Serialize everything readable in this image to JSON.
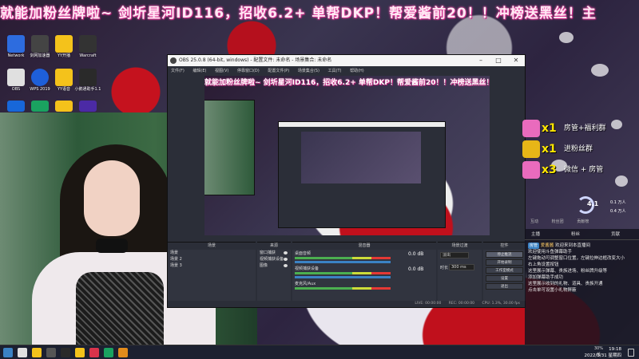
{
  "marquee": {
    "text": "就能加粉丝牌啦~  剑圻星河ID116，招收6.2+ 单帮DKP！帮爱酱前20！！冲榜送黑丝！主"
  },
  "desktop_icons": [
    {
      "label": "Network",
      "icon": "network-icon",
      "color": "#2d6cdf"
    },
    {
      "label": "剑网加速器",
      "icon": "accelerator-icon",
      "color": "#444"
    },
    {
      "label": "YY开播",
      "icon": "yy-live-icon",
      "color": "#f4c21b"
    },
    {
      "label": "Warcraft",
      "icon": "warcraft-icon",
      "color": "#333"
    },
    {
      "label": "OBS",
      "icon": "obs-icon",
      "color": "#e0e0e0"
    },
    {
      "label": "WPS 2019",
      "icon": "wps-icon",
      "color": "#1e5fd9"
    },
    {
      "label": "YY语音",
      "icon": "yy-voice-icon",
      "color": "#f4c21b"
    },
    {
      "label": "小鹅通助手1.1",
      "icon": "assistant-icon",
      "color": "#2a2a2a"
    },
    {
      "label": "",
      "icon": "app-blue-icon",
      "color": "#1767d9"
    },
    {
      "label": "",
      "icon": "app-m-icon",
      "color": "#1aa260"
    },
    {
      "label": "",
      "icon": "app-yy-icon",
      "color": "#f4c21b"
    },
    {
      "label": "",
      "icon": "app-game-icon",
      "color": "#4b2aa5"
    }
  ],
  "obs": {
    "title": "OBS 25.0.8 (64-bit, windows) - 配置文件: 未命名 - 场景集合: 未命名",
    "window_buttons": [
      "–",
      "□",
      "✕"
    ],
    "menu": [
      "文件(F)",
      "编辑(E)",
      "视图(V)",
      "停靠窗口(D)",
      "配置文件(P)",
      "场景集合(S)",
      "工具(T)",
      "帮助(H)"
    ],
    "preview_text": "就能加粉丝牌啦~  剑圻星河ID116，招收6.2+ 单帮DKP！帮爱酱前20！！冲榜送黑丝！主",
    "docks": {
      "scenes": {
        "header": "场景",
        "items": [
          "场景",
          "场景 2",
          "场景 3"
        ]
      },
      "sources": {
        "header": "来源",
        "items": [
          "窗口捕获",
          "视频捕获设备",
          "图像"
        ]
      },
      "mixer": {
        "header": "混音器",
        "tracks": [
          {
            "name": "桌面音频",
            "volume": "0.0 dB"
          },
          {
            "name": "视频捕获设备",
            "volume": "0.0 dB"
          },
          {
            "name": "麦克风/Aux",
            "volume": "0.0 dB"
          }
        ]
      },
      "transitions": {
        "header": "场景过渡",
        "type": "淡出",
        "duration_label": "时长",
        "duration": "300 ms"
      },
      "controls": {
        "header": "控件",
        "buttons": [
          "停止推流",
          "开始录制",
          "工作室模式",
          "设置",
          "退出"
        ]
      }
    },
    "status": {
      "live": "LIVE: 00:00:00",
      "rec": "REC: 00:00:00",
      "cpu": "CPU: 1.3%, 30.00 fps"
    }
  },
  "gifts": [
    {
      "count": "x1",
      "label": "房管+福利群",
      "icon": "gift-avatar-icon",
      "color": "#e96bbd"
    },
    {
      "count": "x1",
      "label": "进粉丝群",
      "icon": "gift-gold-icon",
      "color": "#e7b617"
    },
    {
      "count": "x3",
      "label": "微信 + 房管",
      "icon": "gift-avatar-icon",
      "color": "#e96bbd"
    }
  ],
  "stats": {
    "gauge_value": "4.1",
    "line1": "0.1 万人",
    "line2": "0.4 万人",
    "bottom": [
      "互动",
      "粉丝团",
      "贡献榜"
    ]
  },
  "chat": {
    "tabs": [
      "主播",
      "粉丝",
      "贡献"
    ],
    "welcome_badge": "房管",
    "welcome_user": "爱酱酱",
    "welcome_text": "欢迎来到本直播间",
    "lines": [
      "欢迎使用斗鱼弹幕助手",
      "左键拖动可调整窗口位置，左键拉伸边框改变大小",
      "右上角设置按钮",
      "这里展示弹幕、贵族进场、粉丝牌升级等",
      "添加弹幕助手成功",
      "",
      "这里展示收到的礼物、道具、贵族开通",
      "点击单可设置小礼物屏蔽"
    ]
  },
  "taskbar": {
    "tray_line1": "30%",
    "tray_line2": "低",
    "time": "19:18",
    "date": "2022/3/31 星期四"
  }
}
